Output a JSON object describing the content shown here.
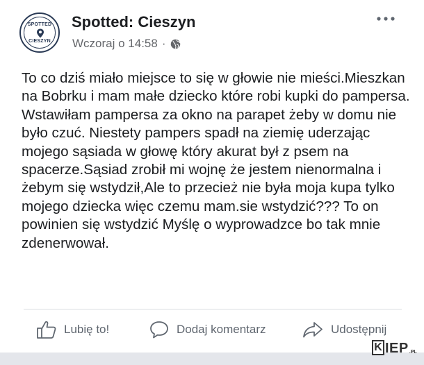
{
  "post": {
    "page_name": "Spotted: Cieszyn",
    "avatar_text_top": "SPOTTED",
    "avatar_text_bottom": "CIESZYN",
    "timestamp": "Wczoraj o 14:58",
    "separator": "·",
    "globe_icon": "globe-icon",
    "more_icon": "more-options-icon",
    "text": "To co dziś miało miejsce to się w głowie nie mieści.Mieszkan na Bobrku i mam małe dziecko które robi kupki do pampersa. Wstawiłam pampersa za okno na parapet żeby w domu nie było czuć. Niestety pampers spadł na ziemię uderzając mojego sąsiada w głowę który akurat był z psem na spacerze.Sąsiad zrobił mi wojnę że jestem nienormalna i żebym się wstydził,Ale to przecież nie była moja kupa tylko mojego dziecka więc czemu mam.sie wstydzić??? To on powinien się wstydzić Myślę o wyprowadzce bo tak mnie zdenerwował."
  },
  "actions": {
    "like_label": "Lubię to!",
    "comment_label": "Dodaj komentarz",
    "share_label": "Udostępnij"
  },
  "watermark": {
    "box_letter": "K",
    "text": "IEP",
    "suffix": ".PL"
  },
  "colors": {
    "text": "#1c1e21",
    "secondary": "#65676b",
    "action": "#606770",
    "divider": "#dadde1"
  }
}
